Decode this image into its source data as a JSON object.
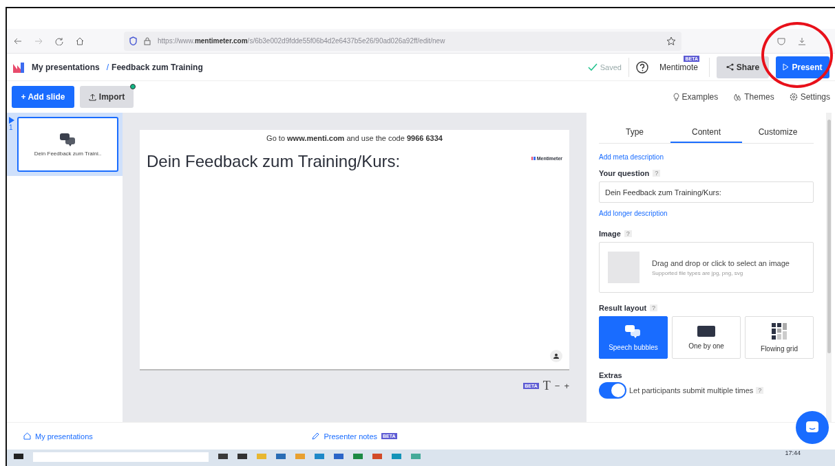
{
  "browser": {
    "url": "https://www.**mentimeter.com**/s/6b3e002d9fdde55f06b4d2e6437b5e26/90ad026a92ff/edit/new"
  },
  "header": {
    "breadcrumb": [
      "My presentations",
      "Feedback zum Training"
    ],
    "separator": "/",
    "saved": "Saved",
    "mentimote": "Mentimote",
    "mentimote_badge": "BETA",
    "share": "Share",
    "present": "Present"
  },
  "toolbar": {
    "add_slide": "+ Add slide",
    "import": "Import",
    "links": [
      "Examples",
      "Themes",
      "Settings"
    ]
  },
  "slides": [
    {
      "number": "1",
      "title": "Dein Feedback zum Traini..",
      "selected": true
    }
  ],
  "slide": {
    "code_line": "Go to **www.menti.com** and use the code **9966 6334**",
    "logo": "Mentimeter",
    "question": "Dein Feedback zum Training/Kurs:"
  },
  "canvas_tools": {
    "badge": "BETA",
    "font": "T",
    "minus": "−",
    "plus": "+"
  },
  "panel": {
    "tabs": [
      {
        "label": "Type",
        "selected": false
      },
      {
        "label": "Content",
        "selected": true
      },
      {
        "label": "Customize",
        "selected": false
      }
    ],
    "meta_link": "Add meta description",
    "question_label": "Your question",
    "question_value": "Dein Feedback zum Training/Kurs:",
    "longer_link": "Add longer description",
    "image_label": "Image",
    "image_hint": "Drag and drop or click to select an image",
    "image_sub": "Supported file types are jpg, png, svg",
    "layout_label": "Result layout",
    "layouts": [
      {
        "label": "Speech bubbles",
        "kind": "bubbles",
        "selected": true
      },
      {
        "label": "One by one",
        "kind": "card",
        "selected": false
      },
      {
        "label": "Flowing grid",
        "kind": "grid",
        "selected": false
      }
    ],
    "extras_label": "Extras",
    "toggle": {
      "label": "Let participants submit multiple times",
      "on": true
    },
    "help": "?"
  },
  "footer": {
    "home": "My presentations",
    "notes": "Presenter notes",
    "notes_badge": "BETA"
  },
  "taskbar": {
    "clock": "17:44"
  }
}
